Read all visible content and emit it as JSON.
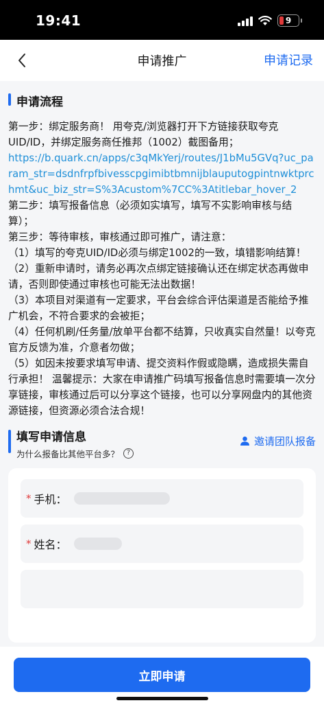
{
  "status": {
    "time": "19:41",
    "battery": "9"
  },
  "nav": {
    "title": "申请推广",
    "records": "申请记录"
  },
  "flow": {
    "title": "申请流程",
    "step1": "第一步：绑定服务商！ 用夸克/浏览器打开下方链接获取夸克UID/ID，并绑定服务商任推邦（1002）截图备用；",
    "link": "https://b.quark.cn/apps/c3qMkYerj/routes/J1bMu5GVq?uc_param_str=dsdnfrpfbivesscpgimibtbmnijblauputogpintnwktprchmt&uc_biz_str=S%3Acustom%7CC%3Atitlebar_hover_2",
    "step2": "第二步：填写报备信息（必须如实填写，填写不实影响审核与结算）；",
    "step3": "第三步：等待审核，审核通过即可推广，请注意：",
    "notes": [
      "（1）填写的夸克UID/ID必须与绑定1002的一致，填错影响结算！",
      "（2）重新申请时，请务必再次点绑定链接确认还在绑定状态再做申请，否则即使通过审核也可能无法出数据！",
      "（3）本项目对渠道有一定要求，平台会综合评估渠道是否能给予推广机会，不符合要求的会被拒；",
      "（4）任何机刷/任务量/放单平台都不结算，只收真实自然量！以夸克官方反馈为准，介意者勿做；",
      "（5）如因未按要求填写申请、提交资料作假或隐瞒，造成损失需自行承担！ 温馨提示：大家在申请推广码填写报备信息时需要填一次分享链接，审核通过后可以分享这个链接，也可以分享网盘内的其他资源链接，但资源必须合法合规！"
    ]
  },
  "form": {
    "title": "填写申请信息",
    "subtitle": "为什么报备比其他平台多？",
    "invite": "邀请团队报备",
    "fields": [
      {
        "required": "*",
        "label": "手机："
      },
      {
        "required": "*",
        "label": "姓名："
      }
    ]
  },
  "submit": "立即申请",
  "colors": {
    "accent": "#1e6bf0",
    "link": "#1e8fd8",
    "required": "#e03a3a"
  }
}
